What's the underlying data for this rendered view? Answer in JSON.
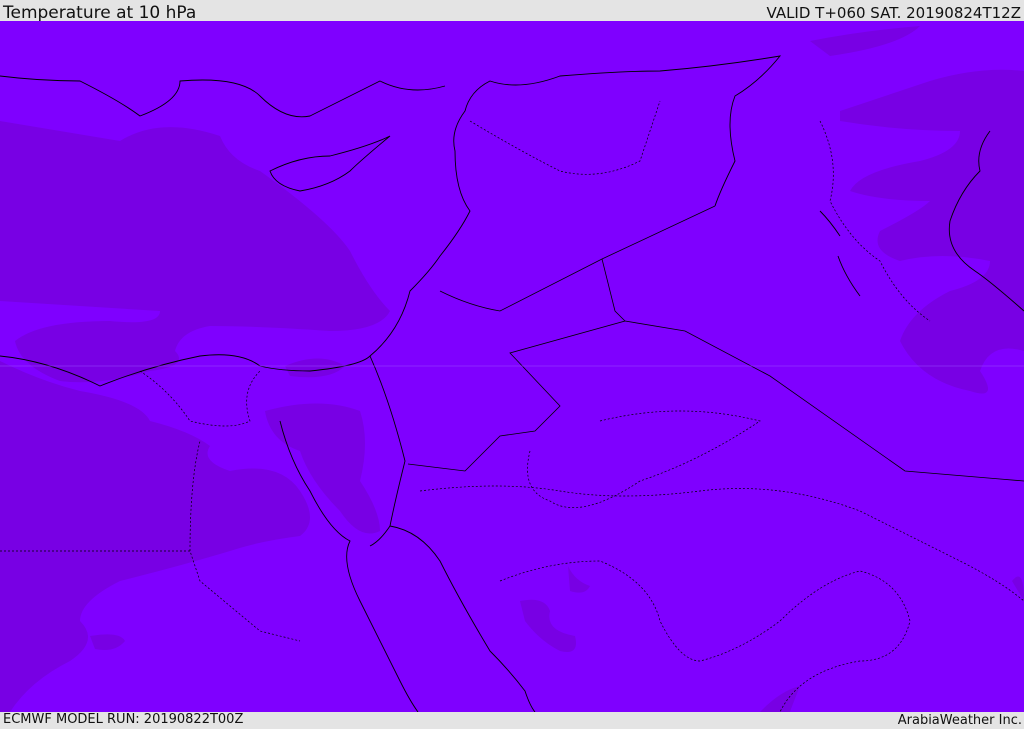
{
  "header": {
    "title": "Temperature at 10 hPa",
    "valid_time": "VALID T+060 SAT. 20190824T12Z"
  },
  "footer": {
    "model_run": "ECMWF MODEL RUN: 20190822T00Z",
    "credit": "ArabiaWeather Inc."
  },
  "colors": {
    "base_fill": "#7f00ff",
    "darker_fill": "#7800e4",
    "background": "#e4e4e4"
  }
}
